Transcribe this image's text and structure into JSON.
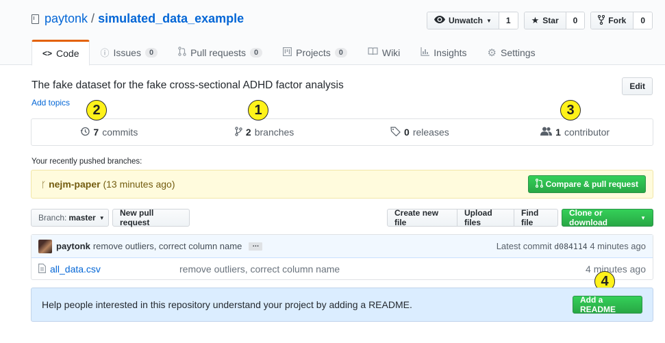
{
  "repo": {
    "owner": "paytonk",
    "separator": "/",
    "name": "simulated_data_example"
  },
  "actions": {
    "watch": {
      "label": "Unwatch",
      "count": "1"
    },
    "star": {
      "label": "Star",
      "count": "0"
    },
    "fork": {
      "label": "Fork",
      "count": "0"
    }
  },
  "tabs": [
    {
      "label": "Code",
      "count": null,
      "icon": "code-icon"
    },
    {
      "label": "Issues",
      "count": "0",
      "icon": "issue-icon"
    },
    {
      "label": "Pull requests",
      "count": "0",
      "icon": "pull-request-icon"
    },
    {
      "label": "Projects",
      "count": "0",
      "icon": "project-icon"
    },
    {
      "label": "Wiki",
      "count": null,
      "icon": "book-icon"
    },
    {
      "label": "Insights",
      "count": null,
      "icon": "graph-icon"
    },
    {
      "label": "Settings",
      "count": null,
      "icon": "gear-icon"
    }
  ],
  "description": "The fake dataset for the fake cross-sectional ADHD factor analysis",
  "add_topics": "Add topics",
  "edit_label": "Edit",
  "summary": {
    "commits": {
      "count": "7",
      "label": "commits"
    },
    "branches": {
      "count": "2",
      "label": "branches"
    },
    "releases": {
      "count": "0",
      "label": "releases"
    },
    "contributors": {
      "count": "1",
      "label": "contributor"
    }
  },
  "markers": {
    "m1": "1",
    "m2": "2",
    "m3": "3",
    "m4": "4"
  },
  "recent": {
    "label": "Your recently pushed branches:",
    "branch": "nejm-paper",
    "time": "(13 minutes ago)",
    "compare_label": "Compare & pull request"
  },
  "toolbar": {
    "branch_prefix": "Branch:",
    "branch_name": "master",
    "new_pr": "New pull request",
    "create_file": "Create new file",
    "upload_files": "Upload files",
    "find_file": "Find file",
    "clone": "Clone or download"
  },
  "latest_commit": {
    "author": "paytonk",
    "message": "remove outliers, correct column name",
    "ellipsis": "…",
    "prefix": "Latest commit",
    "sha": "d084114",
    "age": "4 minutes ago"
  },
  "files": [
    {
      "name": "all_data.csv",
      "message": "remove outliers, correct column name",
      "age": "4 minutes ago"
    }
  ],
  "readme": {
    "text": "Help people interested in this repository understand your project by adding a README.",
    "button": "Add a README"
  },
  "colors": {
    "link": "#0366d6",
    "accent_tab": "#e36209",
    "green": "#28a745",
    "marker": "#fff21a"
  }
}
